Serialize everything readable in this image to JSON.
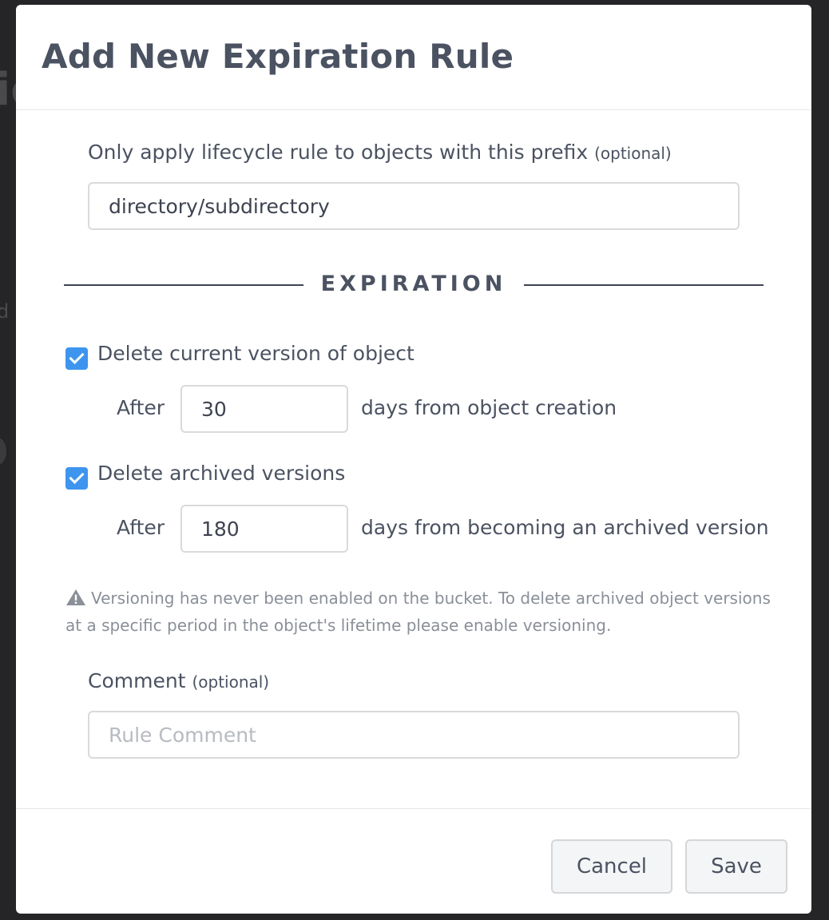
{
  "modal": {
    "title": "Add New Expiration Rule"
  },
  "prefix": {
    "label": "Only apply lifecycle rule to objects with this prefix",
    "optional": "(optional)",
    "value": "directory/subdirectory"
  },
  "section": {
    "title": "EXPIRATION"
  },
  "current_version": {
    "checked": true,
    "label": "Delete current version of object",
    "after_label": "After",
    "days_value": "30",
    "days_text": "days from object creation"
  },
  "archived_versions": {
    "checked": true,
    "label": "Delete archived versions",
    "after_label": "After",
    "days_value": "180",
    "days_text": "days from becoming an archived version"
  },
  "warning": {
    "icon": "warning-icon",
    "text": "Versioning has never been enabled on the bucket. To delete archived object versions at a specific period in the object's lifetime please enable versioning."
  },
  "comment": {
    "label": "Comment",
    "optional": "(optional)",
    "value": "",
    "placeholder": "Rule Comment"
  },
  "footer": {
    "cancel_label": "Cancel",
    "save_label": "Save"
  },
  "colors": {
    "checkbox": "#3d95ee",
    "text": "#4b5261",
    "overlay": "#252527"
  }
}
